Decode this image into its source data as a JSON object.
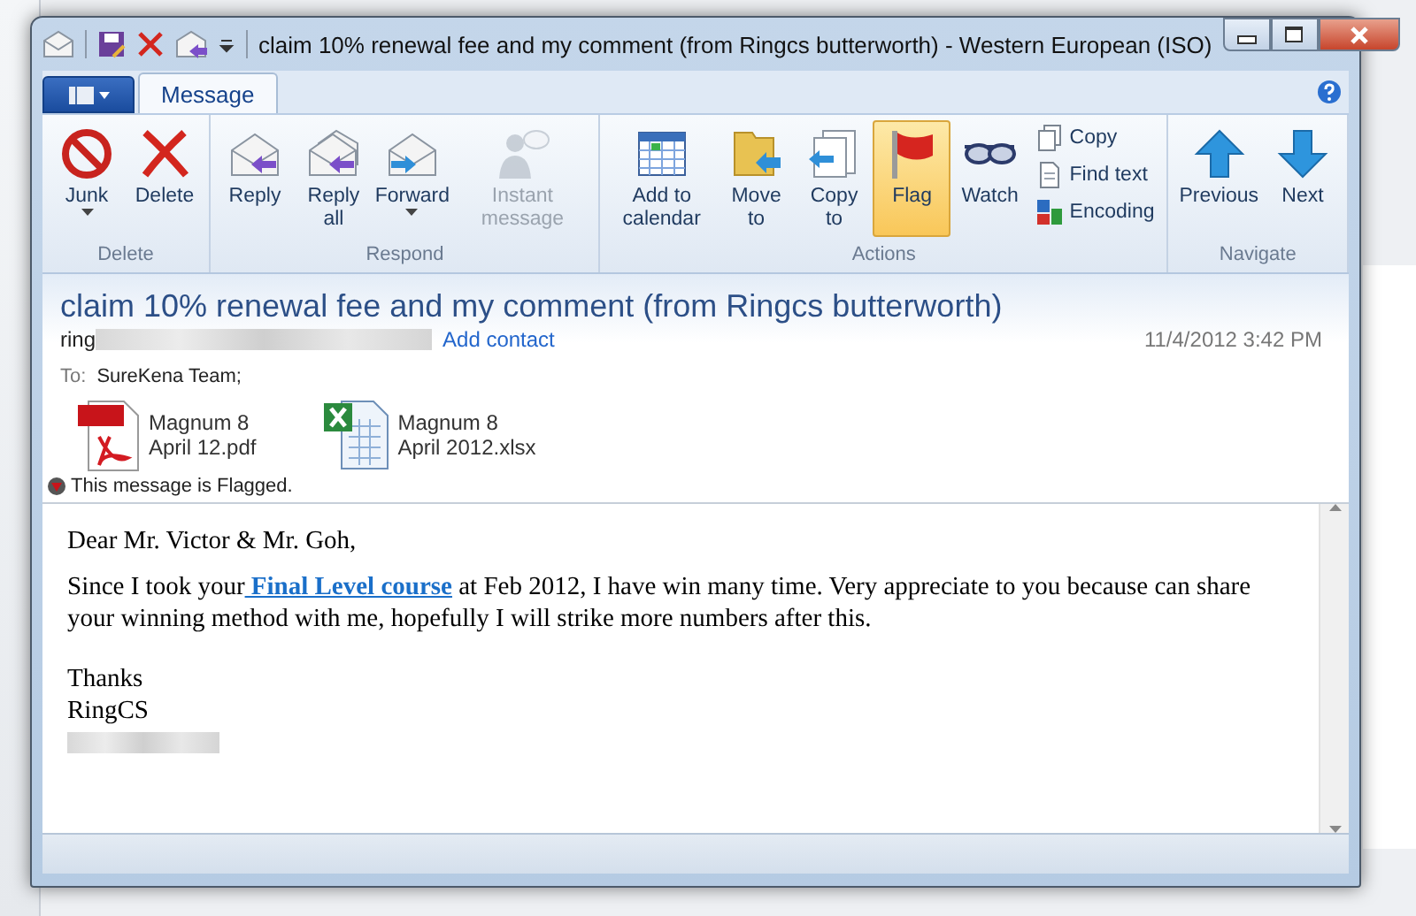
{
  "window": {
    "title": "claim 10% renewal fee and my comment (from Ringcs butterworth) - Western European (ISO)"
  },
  "ribbon": {
    "tabs": [
      {
        "label": "Message",
        "selected": true
      }
    ],
    "groups": [
      {
        "label": "Delete",
        "buttons": [
          {
            "kind": "large",
            "label": "Junk",
            "dropdown": true,
            "disabled": false,
            "selected": false
          },
          {
            "kind": "large",
            "label": "Delete",
            "dropdown": false,
            "disabled": false,
            "selected": false
          }
        ]
      },
      {
        "label": "Respond",
        "buttons": [
          {
            "kind": "large",
            "label": "Reply",
            "dropdown": false,
            "disabled": false,
            "selected": false
          },
          {
            "kind": "large",
            "label": "Reply all",
            "dropdown": false,
            "disabled": false,
            "selected": false
          },
          {
            "kind": "large",
            "label": "Forward",
            "dropdown": true,
            "disabled": false,
            "selected": false
          },
          {
            "kind": "large",
            "label": "Instant message",
            "dropdown": false,
            "disabled": true,
            "selected": false
          }
        ]
      },
      {
        "label": "Actions",
        "buttons": [
          {
            "kind": "large",
            "label": "Add to calendar",
            "dropdown": false,
            "disabled": false,
            "selected": false
          },
          {
            "kind": "large",
            "label": "Move to",
            "dropdown": false,
            "disabled": false,
            "selected": false
          },
          {
            "kind": "large",
            "label": "Copy to",
            "dropdown": false,
            "disabled": false,
            "selected": false
          },
          {
            "kind": "large",
            "label": "Flag",
            "dropdown": false,
            "disabled": false,
            "selected": true
          },
          {
            "kind": "large",
            "label": "Watch",
            "dropdown": false,
            "disabled": false,
            "selected": false
          },
          {
            "kind": "small",
            "items": [
              {
                "label": "Copy"
              },
              {
                "label": "Find text"
              },
              {
                "label": "Encoding"
              }
            ]
          }
        ]
      },
      {
        "label": "Navigate",
        "buttons": [
          {
            "kind": "large",
            "label": "Previous",
            "dropdown": false,
            "disabled": false,
            "selected": false
          },
          {
            "kind": "large",
            "label": "Next",
            "dropdown": false,
            "disabled": false,
            "selected": false
          }
        ]
      }
    ]
  },
  "header": {
    "subject": "claim 10% renewal fee and my comment (from Ringcs butterworth)",
    "sender": "ring",
    "sender_redacted": true,
    "add_contact": "Add contact",
    "date": "11/4/2012 3:42 PM",
    "to_label": "To:",
    "to": "SureKena Team;",
    "attachments": [
      {
        "kind": "pdf",
        "lines": [
          "Magnum 8",
          "April 12.pdf"
        ]
      },
      {
        "kind": "xlsx",
        "lines": [
          "Magnum 8",
          "April 2012.xlsx"
        ]
      }
    ],
    "flag_notice": "This message is Flagged."
  },
  "body": {
    "greeting": "Dear Mr. Victor & Mr. Goh,",
    "paragraph": {
      "before": "Since I took your",
      "link": " Final Level course",
      "after": " at Feb 2012, I have win many time. Very appreciate to you because can share your winning method with me, hopefully I will strike more numbers after this."
    },
    "closing": [
      "Thanks",
      "RingCS"
    ],
    "signature_redacted": true
  }
}
